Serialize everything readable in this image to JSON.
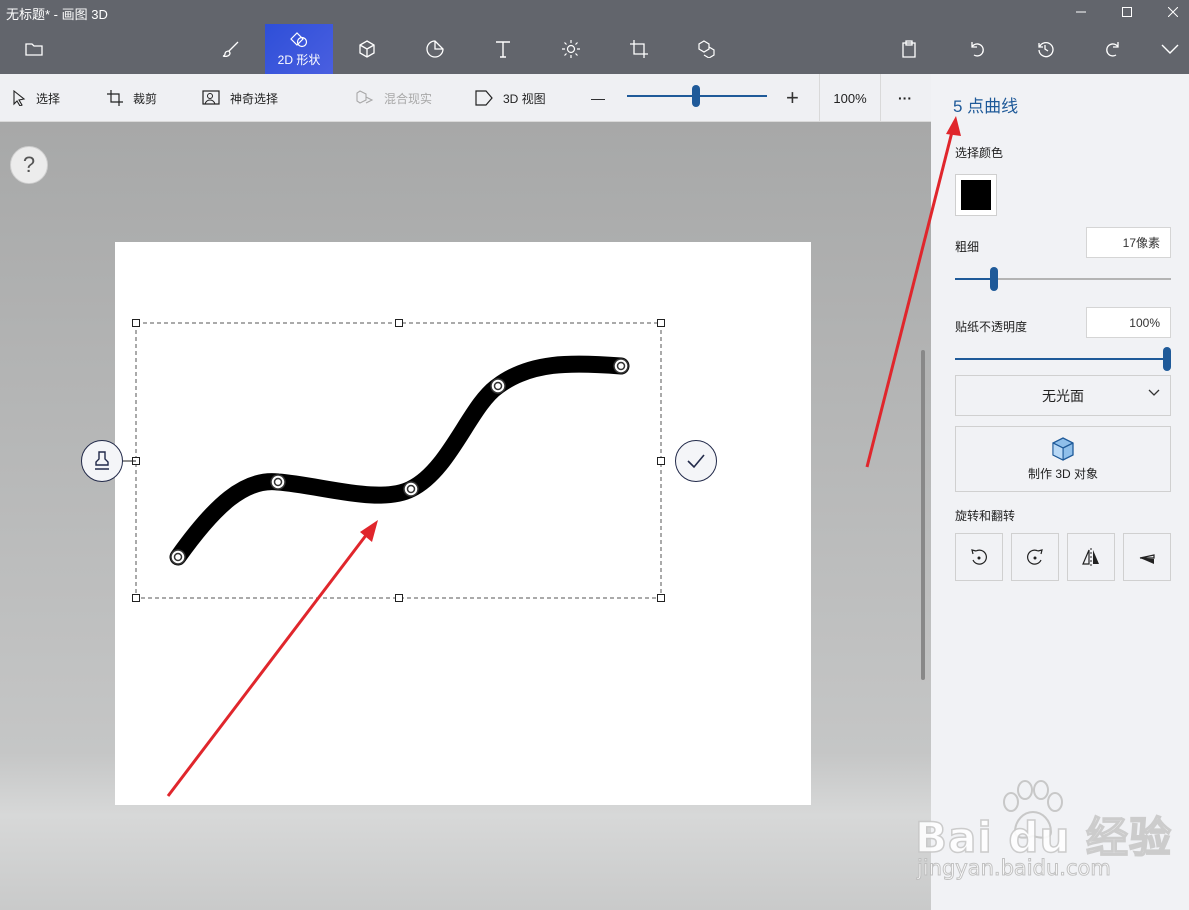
{
  "window": {
    "title": "无标题* - 画图 3D"
  },
  "ribbon": {
    "items": [
      {
        "name": "file-menu",
        "icon": "folder-icon",
        "label": ""
      },
      {
        "name": "brushes",
        "icon": "brush-icon",
        "label": ""
      },
      {
        "name": "2d-shapes",
        "icon": "2d-shapes-icon",
        "label": "2D 形状",
        "active": true
      },
      {
        "name": "3d-shapes",
        "icon": "cube-icon",
        "label": ""
      },
      {
        "name": "stickers",
        "icon": "sticker-icon",
        "label": ""
      },
      {
        "name": "text",
        "icon": "text-icon",
        "label": ""
      },
      {
        "name": "effects",
        "icon": "sun-icon",
        "label": ""
      },
      {
        "name": "canvas",
        "icon": "canvas-icon",
        "label": ""
      },
      {
        "name": "3d-library",
        "icon": "3d-library-icon",
        "label": ""
      }
    ],
    "right": [
      "paste-icon",
      "undo-icon",
      "history-icon",
      "redo-icon",
      "expand-icon"
    ]
  },
  "toolbar": {
    "select": "选择",
    "crop": "裁剪",
    "magic_select": "神奇选择",
    "mixed_reality": "混合现实",
    "view_3d": "3D 视图",
    "zoom_out": "—",
    "zoom_in": "+",
    "zoom": "100%",
    "zoom_level": 0.5,
    "more": "···"
  },
  "workspace": {
    "help": "?"
  },
  "panel": {
    "title": "5 点曲线",
    "color_label": "选择颜色",
    "color": "#000000",
    "thickness_label": "粗细",
    "thickness_value": "17像素",
    "thickness_level": 0.17,
    "opacity_label": "贴纸不透明度",
    "opacity_value": "100%",
    "opacity_level": 1.0,
    "finish_select": "无光面",
    "make_3d": "制作 3D 对象",
    "rotate_label": "旋转和翻转",
    "rotate_buttons": [
      "rotate-left-icon",
      "rotate-right-icon",
      "flip-horizontal-icon",
      "flip-vertical-icon"
    ]
  },
  "watermark": {
    "brand": "Bai du 经验",
    "url": "jingyan.baidu.com"
  },
  "colors": {
    "accent": "#1f5a99",
    "active_tab": "#3b57d6",
    "arrow": "#e0262c"
  }
}
